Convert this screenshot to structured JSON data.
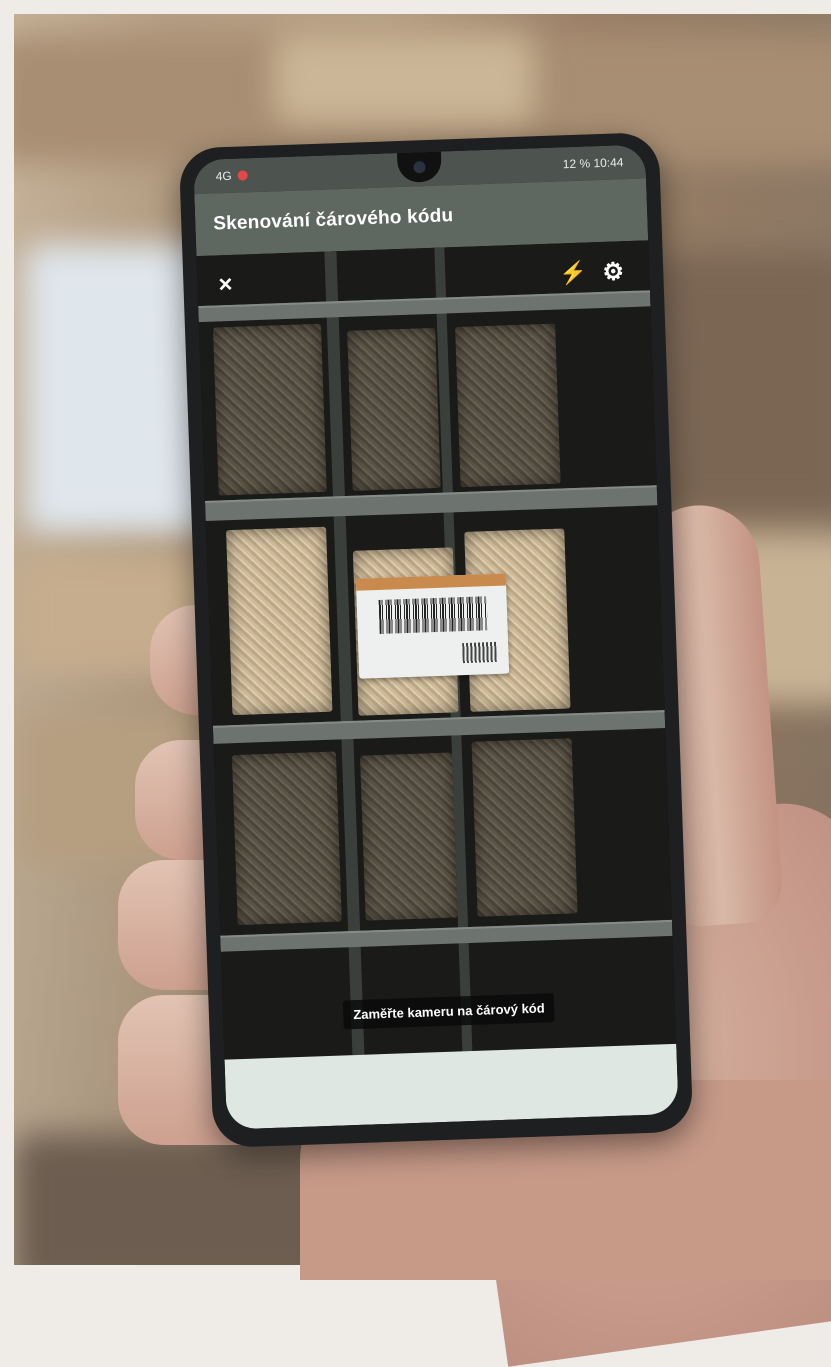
{
  "status_bar": {
    "left_indicator": "4G",
    "right_text": "12 %  10:44"
  },
  "app_bar": {
    "title": "Skenování čárového kódu"
  },
  "camera": {
    "close_icon": "×",
    "flash_icon": "⚡",
    "settings_icon": "⚙",
    "hint": "Zaměřte kameru na čárový kód"
  },
  "colors": {
    "app_bar": "#5f6761",
    "status_bar": "#4d5450",
    "bottom_panel": "#dfe7e2",
    "hint_bg": "#0a0a0a"
  }
}
